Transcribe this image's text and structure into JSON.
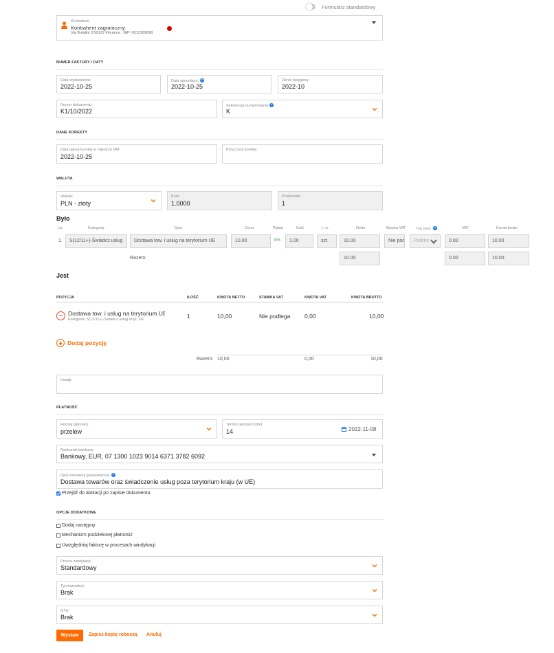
{
  "toggle": {
    "label": "Formularz standardowy",
    "on": false
  },
  "contractor": {
    "label": "Kontrahent",
    "name": "Kontrahent zagraniczny",
    "address": "Via Bufalini 3 50122 Florence , NIP: 0012189698",
    "status_color": "#d00000"
  },
  "sections": {
    "invoice": "NUMER FAKTURY I DATY",
    "correction": "DANE KOREKTY",
    "currency": "WALUTA",
    "payment": "PŁATNOŚĆ",
    "options": "OPCJE DODATKOWE"
  },
  "dates": {
    "issue": {
      "label": "Data wystawienia:",
      "value": "2022-10-25"
    },
    "sale": {
      "label": "Data sprzedaży:",
      "value": "2022-10-25"
    },
    "period": {
      "label": "Okres księgowy:",
      "value": "2022-10"
    },
    "number": {
      "label": "Numer dokumentu:",
      "value": "K1/10/2022"
    },
    "sequence": {
      "label": "Sekwencja numerowania",
      "value": "K"
    }
  },
  "correction": {
    "vat_date": {
      "label": "Data ujęcia korekty w rejestrze VAT:",
      "value": "2022-10-25"
    },
    "reason": {
      "label": "Przyczyna korekty",
      "value": ""
    }
  },
  "currency": {
    "currency": {
      "label": "Waluta:",
      "value": "PLN - złoty"
    },
    "rate": {
      "label": "Kurs:",
      "value": "1.0000"
    },
    "converter": {
      "label": "Przelicznik:",
      "value": "1"
    }
  },
  "bylo": {
    "title": "Było",
    "headers": [
      "Lp.",
      "Kategoria",
      "Opis",
      "Cena",
      "Rabat",
      "Ilość",
      "j. m.",
      "Netto",
      "Stawka VAT",
      "Typ zwol.",
      "VAT",
      "Kwota brutto"
    ],
    "row": {
      "lp": "1.",
      "category": "S(12/11+)-Świadcz.usług",
      "desc": "Dostawa tow. i usług na terytorium UE",
      "price": "10.00",
      "discount": "0%",
      "qty": "1.00",
      "unit": "szt.",
      "net": "10.00",
      "vat_rate": "Nie podlega",
      "exempt": "Podmiot",
      "vat": "0.00",
      "gross": "10.00"
    },
    "total_label": "Razem:",
    "totals": {
      "net": "10.00",
      "vat": "0.00",
      "gross": "10.00"
    }
  },
  "jest": {
    "title": "Jest",
    "headers": {
      "position": "POZYCJA",
      "qty": "ILOŚĆ",
      "net": "KWOTA NETTO",
      "vat_rate": "STAWKA VAT",
      "vat": "KWOTA VAT",
      "gross": "KWOTA BRUTTO"
    },
    "row": {
      "name": "Dostawa tow. i usług na terytorium UE",
      "category": "Kategoria: S(12/11+)-Świadcz.usług teryt. UE",
      "qty": "1",
      "net": "10,00",
      "vat_rate": "Nie podlega",
      "vat": "0,00",
      "gross": "10,00"
    },
    "add_label": "Dodaj pozycję",
    "total_label": "Razem:",
    "totals": {
      "net": "10,00",
      "vat": "0,00",
      "gross": "10,00"
    }
  },
  "notes": {
    "label": "Uwagi:",
    "value": ""
  },
  "payment": {
    "type": {
      "label": "Rodzaj płatności:",
      "value": "przelew"
    },
    "term": {
      "label": "Termin płatności (dni):",
      "value": "14",
      "date": "2022-11-08"
    },
    "account": {
      "label": "Rachunek bankowy",
      "value": "Bankowy, EUR, 07 1300 1023 9014 6371 3782 6092"
    },
    "description": {
      "label": "Opis transakcji gospodarczej:",
      "value": "Dostawa towarów oraz świadczenie usług poza terytorium kraju   (w UE)"
    },
    "alloc_label": "Przejdź do alokacji po zapisie dokumentu",
    "alloc_checked": true
  },
  "options": {
    "add_next": "Dodaj następny",
    "split_payment": "Mechanizm podzielonej płatności",
    "collection": "Uwzględniaj fakturę w procesach windykacji",
    "collection_process": {
      "label": "Proces windykacji",
      "value": "Standardowy"
    },
    "transaction_type": {
      "label": "Typ transakcji:",
      "value": "Brak"
    },
    "gtu": {
      "label": "GTU:",
      "value": "Brak"
    }
  },
  "actions": {
    "issue": "Wystaw",
    "draft": "Zapisz kopię roboczą",
    "cancel": "Anuluj"
  },
  "colors": {
    "accent": "#ff6a00",
    "info": "#1a73e8",
    "field_border": "#d6d6d6",
    "disabled_bg": "#f0f0f0"
  }
}
